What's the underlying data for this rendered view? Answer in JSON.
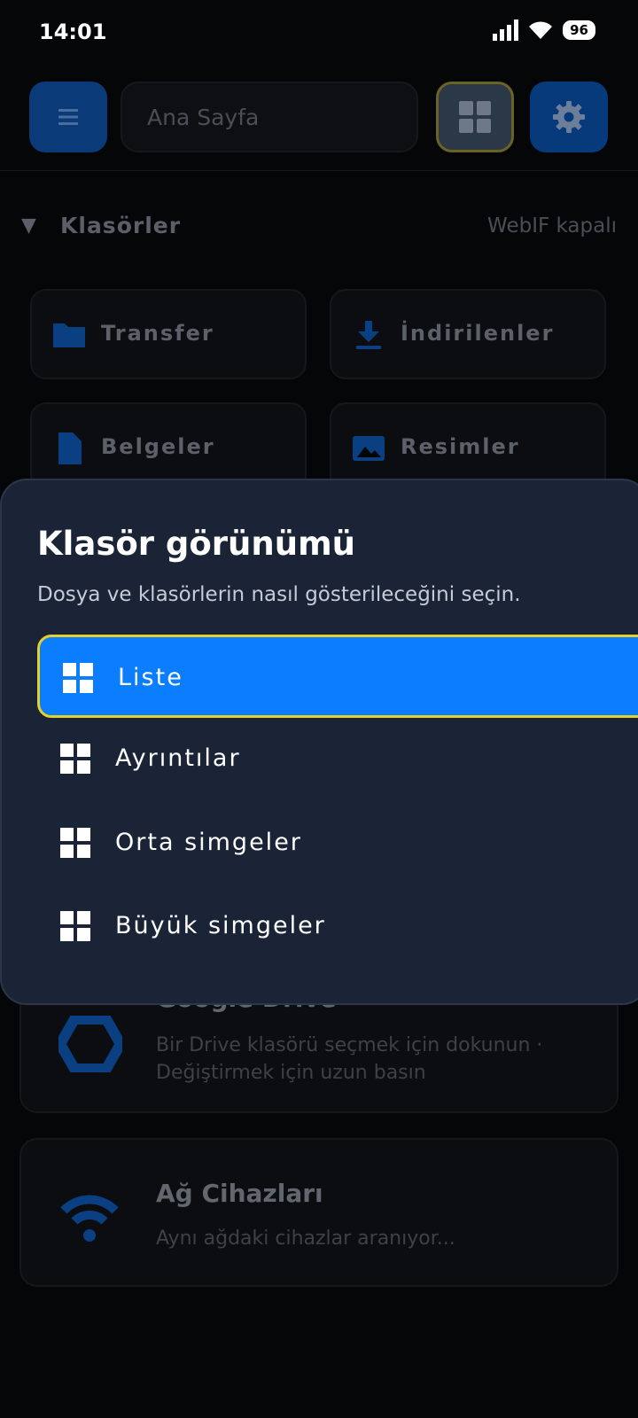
{
  "status_bar": {
    "time": "14:01",
    "battery": "96",
    "signal_icon": "signal-icon",
    "wifi_icon": "wifi-icon"
  },
  "header": {
    "menu_icon": "hamburger-icon",
    "search_placeholder": "Ana Sayfa",
    "view_icon": "grid-icon",
    "settings_icon": "gear-icon"
  },
  "folders_section": {
    "title": "Klasörler",
    "status": "WebIF kapalı",
    "items": [
      {
        "label": "Transfer",
        "icon": "folder-icon"
      },
      {
        "label": "İndirilenler",
        "icon": "download-icon"
      },
      {
        "label": "Belgeler",
        "icon": "document-icon"
      },
      {
        "label": "Resimler",
        "icon": "image-icon"
      }
    ]
  },
  "cards": {
    "drive": {
      "title": "Google Drive",
      "subtitle": "Bir Drive klasörü seçmek için dokunun · Değiştirmek için uzun basın",
      "icon": "drive-icon"
    },
    "network": {
      "title": "Ağ Cihazları",
      "subtitle": "Aynı ağdaki cihazlar aranıyor...",
      "icon": "wifi-icon"
    }
  },
  "dialog": {
    "title": "Klasör görünümü",
    "subtitle": "Dosya ve klasörlerin nasıl gösterileceğini seçin.",
    "options": [
      {
        "label": "Liste",
        "selected": true
      },
      {
        "label": "Ayrıntılar",
        "selected": false
      },
      {
        "label": "Orta simgeler",
        "selected": false
      },
      {
        "label": "Büyük simgeler",
        "selected": false
      }
    ]
  },
  "colors": {
    "accent": "#0b7dff",
    "focus_ring": "#e6cf28",
    "sheet_bg": "#1a2436"
  }
}
